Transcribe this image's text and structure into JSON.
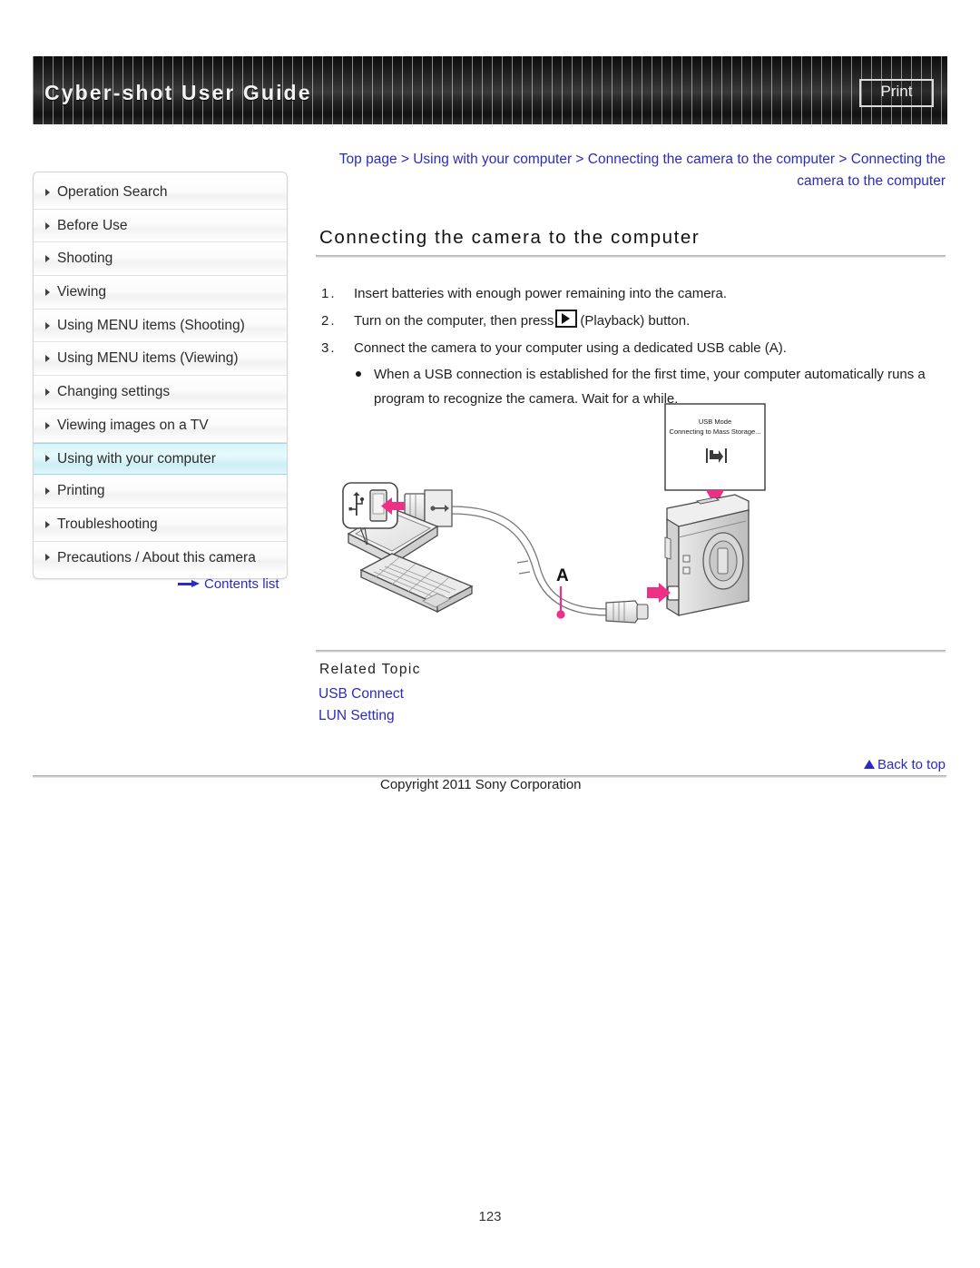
{
  "header": {
    "title": "Cyber-shot User Guide",
    "print_label": "Print"
  },
  "sidebar": {
    "items": [
      {
        "label": "Operation Search",
        "active": false
      },
      {
        "label": "Before Use",
        "active": false
      },
      {
        "label": "Shooting",
        "active": false
      },
      {
        "label": "Viewing",
        "active": false
      },
      {
        "label": "Using MENU items (Shooting)",
        "active": false
      },
      {
        "label": "Using MENU items (Viewing)",
        "active": false
      },
      {
        "label": "Changing settings",
        "active": false
      },
      {
        "label": "Viewing images on a TV",
        "active": false
      },
      {
        "label": "Using with your computer",
        "active": true
      },
      {
        "label": "Printing",
        "active": false
      },
      {
        "label": "Troubleshooting",
        "active": false
      },
      {
        "label": "Precautions / About this camera",
        "active": false
      }
    ],
    "contents_list_label": "Contents list"
  },
  "breadcrumb": {
    "items": [
      "Top page",
      "Using with your computer",
      "Connecting the camera to the computer",
      "Connecting the camera to the computer"
    ],
    "separator": " > "
  },
  "main": {
    "page_title": "Connecting the camera to the computer",
    "steps": [
      {
        "num": "1.",
        "text": "Insert batteries with enough power remaining into the camera."
      },
      {
        "num": "2.",
        "text_before": "Turn on the computer, then press",
        "icon": "playback-icon",
        "text_after": "(Playback) button."
      },
      {
        "num": "3.",
        "text": "Connect the camera to your computer using a dedicated USB cable (A)."
      }
    ],
    "sub_bullet": "When a USB connection is established for the first time, your computer automatically runs a program to recognize the camera. Wait for a while.",
    "illustration": {
      "lcd_line1": "USB Mode",
      "lcd_line2": "Connecting to Mass Storage...",
      "cable_label": "A"
    },
    "related_heading": "Related Topic",
    "related_links": [
      "USB Connect",
      "LUN Setting"
    ]
  },
  "footer": {
    "back_to_top": "Back to top",
    "copyright": "Copyright 2011 Sony Corporation",
    "page_number": "123"
  },
  "colors": {
    "link_blue": "#2b2bbf",
    "accent_magenta": "#ee2f86",
    "highlight_cyan": "#d9f4f9",
    "banner_black": "#1a1a1a"
  }
}
